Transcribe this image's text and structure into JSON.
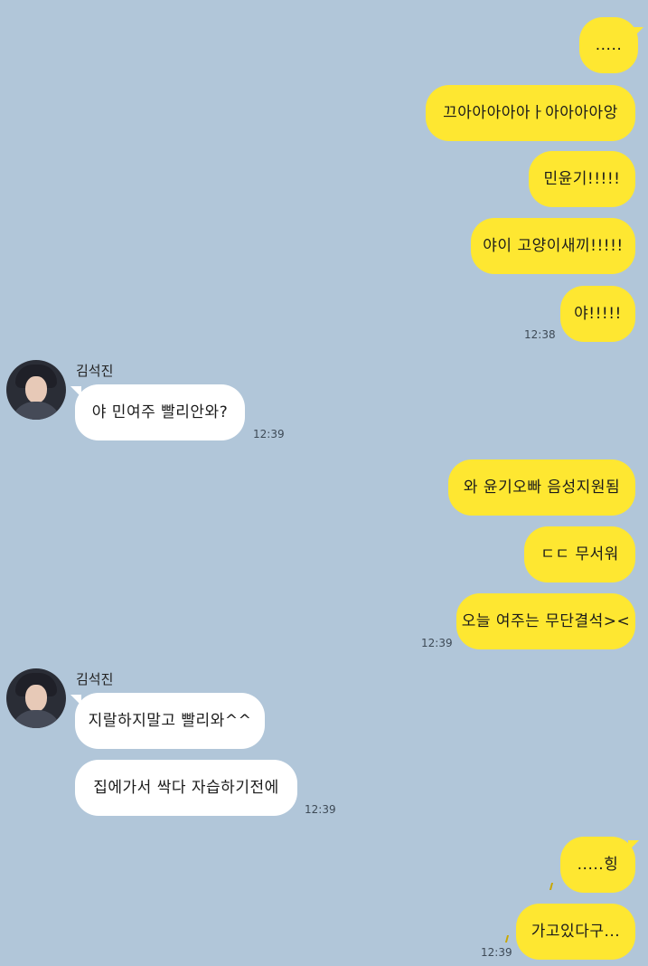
{
  "chat": {
    "contact_name": "김석진",
    "messages": [
      {
        "sender": "me",
        "text": "....."
      },
      {
        "sender": "me",
        "text": "끄아아아아아ㅏ아아아아앙"
      },
      {
        "sender": "me",
        "text": "민윤기!!!!!"
      },
      {
        "sender": "me",
        "text": "야이 고양이새끼!!!!!"
      },
      {
        "sender": "me",
        "text": "야!!!!!",
        "time": "12:38"
      },
      {
        "sender": "김석진",
        "text": "야 민여주 빨리안와?",
        "time": "12:39"
      },
      {
        "sender": "me",
        "text": "와 윤기오빠 음성지원됨"
      },
      {
        "sender": "me",
        "text": "ㄷㄷ 무서워"
      },
      {
        "sender": "me",
        "text": "오늘 여주는 무단결석><",
        "time": "12:39"
      },
      {
        "sender": "김석진",
        "text": "지랄하지말고 빨리와^^"
      },
      {
        "sender": "김석진",
        "text": "집에가서 싹다 자습하기전에",
        "time": "12:39"
      },
      {
        "sender": "me",
        "text": ".....힝"
      },
      {
        "sender": "me",
        "text": "가고있다구...",
        "time": "12:39"
      }
    ]
  },
  "colors": {
    "background": "#b1c6d9",
    "my_bubble": "#fee731",
    "their_bubble": "#ffffff"
  },
  "icons": {
    "avatar": "contact-avatar-photo"
  }
}
